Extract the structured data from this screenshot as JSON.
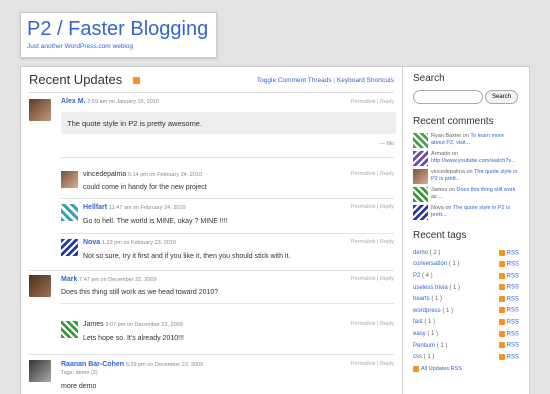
{
  "site": {
    "title": "P2 / Faster Blogging",
    "description": "Just another WordPress.com weblog"
  },
  "main": {
    "title": "Recent Updates",
    "links": {
      "toggle": "Toggle Comment Threads",
      "separator": "|",
      "shortcuts": "Keyboard Shortcuts"
    }
  },
  "permalink_reply": "Permalink | Reply",
  "posts": [
    {
      "author": "Alex M.",
      "meta": "2:59 am on January 15, 2010",
      "quote": "The quote style in P2 is pretty awesome.",
      "signature": "— Mo"
    },
    {
      "author": "vincedepalma",
      "meta": "5:14 pm on February 24, 2010",
      "text": "could come in handy for the new project"
    },
    {
      "author": "Hellfart",
      "meta": "11:47 am on February 24, 2010",
      "text": "Go to hell. The world is MINE, okay ? MINE !!!!"
    },
    {
      "author": "Nova",
      "meta": "1:33 pm on February 23, 2010",
      "text": "Not so sure, try it first and if you like it, then you should stick with it."
    },
    {
      "author": "Mark",
      "meta": "7:47 pm on December 22, 2009",
      "text": "Does this thing still work as we head toward 2010?"
    },
    {
      "author": "James",
      "meta": "9:07 pm on December 22, 2009",
      "text": "Lets hope so. It's already 2010!!!"
    },
    {
      "author": "Raanan Bar-Cohen",
      "meta": "5:29 pm on December 22, 2009",
      "tags": "Tags: demo (2)",
      "text": "more demo"
    }
  ],
  "sidebar": {
    "search": {
      "heading": "Search",
      "placeholder": "",
      "button": "Search"
    },
    "comments": {
      "heading": "Recent comments",
      "items": [
        {
          "who": "Ryan Baxter",
          "on": "on",
          "link": "To learn more about P2, visit..."
        },
        {
          "who": "Armado",
          "on": "on",
          "link": "http://www.youtube.com/watch?v..."
        },
        {
          "who": "vincedepalma",
          "on": "on",
          "link": "The quote style in P2 is prett..."
        },
        {
          "who": "James",
          "on": "on",
          "link": "Does this thing still work as ..."
        },
        {
          "who": "Nova",
          "on": "on",
          "link": "The quote style in P2 is prett..."
        }
      ]
    },
    "tags": {
      "heading": "Recent tags",
      "items": [
        {
          "name": "demo",
          "count": "( 2 )"
        },
        {
          "name": "conversation",
          "count": "( 1 )"
        },
        {
          "name": "P2",
          "count": "( 4 )"
        },
        {
          "name": "useless trivia",
          "count": "( 1 )"
        },
        {
          "name": "hearts",
          "count": "( 1 )"
        },
        {
          "name": "wordpress",
          "count": "( 1 )"
        },
        {
          "name": "fast",
          "count": "( 1 )"
        },
        {
          "name": "easy",
          "count": "( 1 )"
        },
        {
          "name": "Pentium",
          "count": "( 1 )"
        },
        {
          "name": "css",
          "count": "( 1 )"
        }
      ],
      "rss_label": "RSS",
      "all_updates": "All Updates RSS"
    }
  },
  "colors": {
    "link": "#3366cc",
    "rss": "#f7931e",
    "background": "#e3e3e3"
  }
}
